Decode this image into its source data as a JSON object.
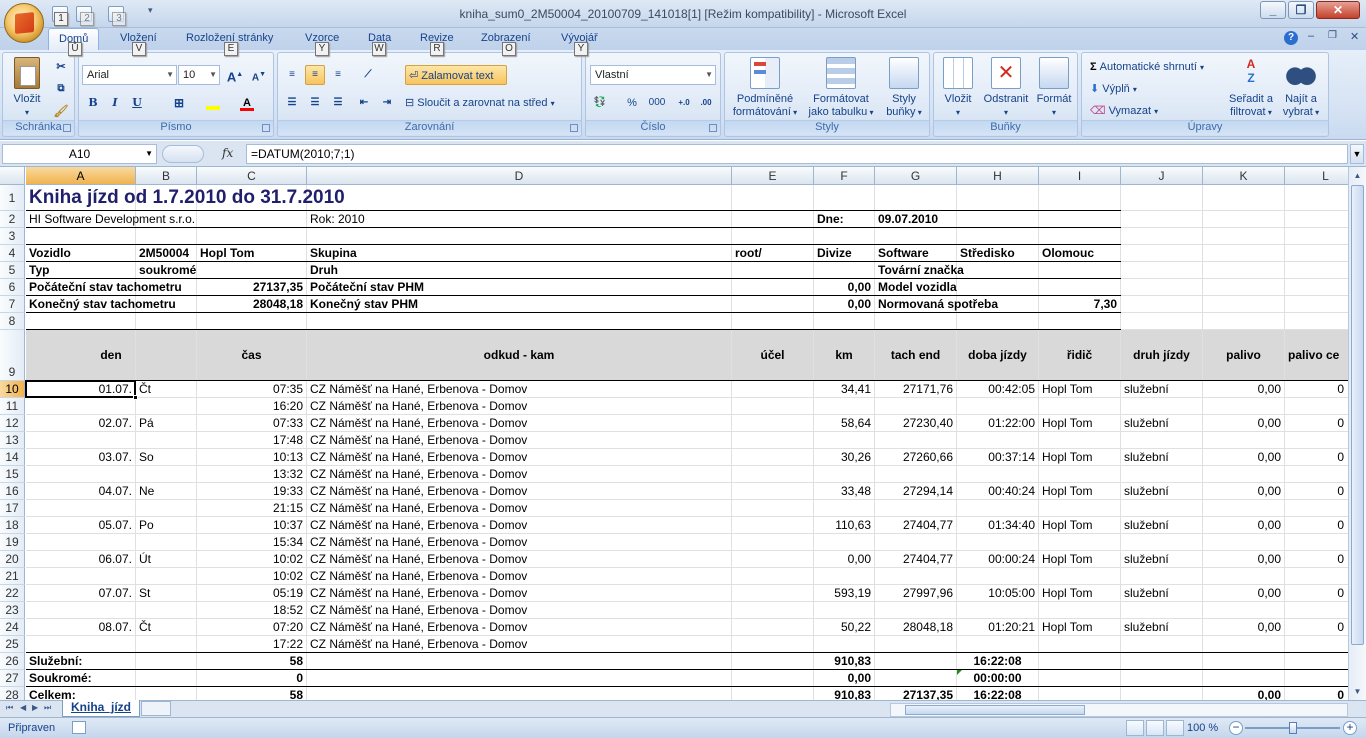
{
  "window": {
    "title": "kniha_sum0_2M50004_20100709_141018[1]  [Režim kompatibility] - Microsoft Excel",
    "qat_keytips": [
      "1",
      "2",
      "3"
    ]
  },
  "tabs": [
    {
      "label": "Domů",
      "keytip": "Ů",
      "active": true
    },
    {
      "label": "Vložení",
      "keytip": "V"
    },
    {
      "label": "Rozložení stránky",
      "keytip": "E"
    },
    {
      "label": "Vzorce",
      "keytip": "Y"
    },
    {
      "label": "Data",
      "keytip": "W"
    },
    {
      "label": "Revize",
      "keytip": "R"
    },
    {
      "label": "Zobrazení",
      "keytip": "O"
    },
    {
      "label": "Vývojář",
      "keytip": "Y"
    }
  ],
  "ribbon": {
    "schranka": {
      "label": "Schránka",
      "paste": "Vložit"
    },
    "pismo": {
      "label": "Písmo",
      "font": "Arial",
      "size": "10",
      "bold": "B",
      "italic": "I",
      "underline": "U",
      "grow": "A",
      "shrink": "A",
      "fill_color": "#ffff00",
      "font_color": "#ff0000"
    },
    "zarovnani": {
      "label": "Zarovnání",
      "wrap": "Zalamovat text",
      "merge": "Sloučit a zarovnat na střed"
    },
    "cislo": {
      "label": "Číslo",
      "format": "Vlastní",
      "percent": "%",
      "thousands": "000"
    },
    "styly": {
      "label": "Styly",
      "cond1": "Podmíněné",
      "cond2": "formátování",
      "table1": "Formátovat",
      "table2": "jako tabulku",
      "cell1": "Styly",
      "cell2": "buňky"
    },
    "bunky": {
      "label": "Buňky",
      "insert": "Vložit",
      "delete": "Odstranit",
      "format": "Formát"
    },
    "upravy": {
      "label": "Úpravy",
      "autosum": "Automatické shrnutí",
      "fill": "Výplň",
      "clear": "Vymazat",
      "sort1": "Seřadit a",
      "sort2": "filtrovat",
      "find1": "Najít a",
      "find2": "vybrat"
    }
  },
  "formula_bar": {
    "name_box": "A10",
    "fx": "fx",
    "formula": "=DATUM(2010;7;1)"
  },
  "columns": [
    "A",
    "B",
    "C",
    "D",
    "E",
    "F",
    "G",
    "H",
    "I",
    "J",
    "K",
    "L"
  ],
  "rows": [
    "1",
    "2",
    "3",
    "4",
    "5",
    "6",
    "7",
    "8",
    "9",
    "10",
    "11",
    "12",
    "13",
    "14",
    "15",
    "16",
    "17",
    "18",
    "19",
    "20",
    "21",
    "22",
    "23",
    "24",
    "25",
    "26",
    "27",
    "28"
  ],
  "sheet": {
    "title": "Kniha jízd od 1.7.2010 do 31.7.2010",
    "company": "HI Software Development s.r.o.",
    "year": "Rok: 2010",
    "date_label": "Dne:",
    "date_value": "09.07.2010",
    "r4": {
      "a": "Vozidlo",
      "b": "2M50004",
      "c": "Hopl Tom",
      "d": "Skupina",
      "e": "root/",
      "f": "Divize",
      "g": "Software",
      "h": "Středisko",
      "i": "Olomouc"
    },
    "r5": {
      "a": "Typ",
      "b": "soukromé",
      "d": "Druh",
      "g": "Tovární značka"
    },
    "r6": {
      "a": "Počáteční stav tachometru",
      "c": "27137,35",
      "d": "Počáteční stav PHM",
      "f": "0,00",
      "g": "Model vozidla"
    },
    "r7": {
      "a": "Konečný stav tachometru",
      "c": "28048,18",
      "d": "Konečný stav PHM",
      "f": "0,00",
      "g": "Normovaná spotřeba",
      "i": "7,30"
    },
    "headers": {
      "a": "den",
      "c": "čas",
      "d": "odkud - kam",
      "e": "účel",
      "f": "km",
      "g": "tach end",
      "h": "doba jízdy",
      "i": "řidič",
      "j": "druh jízdy",
      "k": "palivo",
      "l": "palivo ce"
    },
    "trips": [
      {
        "day": "01.07.",
        "dow": "Čt",
        "start": "07:35",
        "end": "16:20",
        "from": "CZ Náměšť na Hané, Erbenova - Domov",
        "to": "CZ Náměšť na Hané, Erbenova - Domov",
        "km": "34,41",
        "tach": "27171,76",
        "dur": "00:42:05",
        "driver": "Hopl Tom",
        "type": "služební",
        "fuel": "0,00",
        "fuel2": "0"
      },
      {
        "day": "02.07.",
        "dow": "Pá",
        "start": "07:33",
        "end": "17:48",
        "from": "CZ Náměšť na Hané, Erbenova - Domov",
        "to": "CZ Náměšť na Hané, Erbenova - Domov",
        "km": "58,64",
        "tach": "27230,40",
        "dur": "01:22:00",
        "driver": "Hopl Tom",
        "type": "služební",
        "fuel": "0,00",
        "fuel2": "0"
      },
      {
        "day": "03.07.",
        "dow": "So",
        "start": "10:13",
        "end": "13:32",
        "from": "CZ Náměšť na Hané, Erbenova - Domov",
        "to": "CZ Náměšť na Hané, Erbenova - Domov",
        "km": "30,26",
        "tach": "27260,66",
        "dur": "00:37:14",
        "driver": "Hopl Tom",
        "type": "služební",
        "fuel": "0,00",
        "fuel2": "0"
      },
      {
        "day": "04.07.",
        "dow": "Ne",
        "start": "19:33",
        "end": "21:15",
        "from": "CZ Náměšť na Hané, Erbenova - Domov",
        "to": "CZ Náměšť na Hané, Erbenova - Domov",
        "km": "33,48",
        "tach": "27294,14",
        "dur": "00:40:24",
        "driver": "Hopl Tom",
        "type": "služební",
        "fuel": "0,00",
        "fuel2": "0"
      },
      {
        "day": "05.07.",
        "dow": "Po",
        "start": "10:37",
        "end": "15:34",
        "from": "CZ Náměšť na Hané, Erbenova - Domov",
        "to": "CZ Náměšť na Hané, Erbenova - Domov",
        "km": "110,63",
        "tach": "27404,77",
        "dur": "01:34:40",
        "driver": "Hopl Tom",
        "type": "služební",
        "fuel": "0,00",
        "fuel2": "0"
      },
      {
        "day": "06.07.",
        "dow": "Út",
        "start": "10:02",
        "end": "10:02",
        "from": "CZ Náměšť na Hané, Erbenova - Domov",
        "to": "CZ Náměšť na Hané, Erbenova - Domov",
        "km": "0,00",
        "tach": "27404,77",
        "dur": "00:00:24",
        "driver": "Hopl Tom",
        "type": "služební",
        "fuel": "0,00",
        "fuel2": "0"
      },
      {
        "day": "07.07.",
        "dow": "St",
        "start": "05:19",
        "end": "18:52",
        "from": "CZ Náměšť na Hané, Erbenova - Domov",
        "to": "CZ Náměšť na Hané, Erbenova - Domov",
        "km": "593,19",
        "tach": "27997,96",
        "dur": "10:05:00",
        "driver": "Hopl Tom",
        "type": "služební",
        "fuel": "0,00",
        "fuel2": "0"
      },
      {
        "day": "08.07.",
        "dow": "Čt",
        "start": "07:20",
        "end": "17:22",
        "from": "CZ Náměšť na Hané, Erbenova - Domov",
        "to": "CZ Náměšť na Hané, Erbenova - Domov",
        "km": "50,22",
        "tach": "28048,18",
        "dur": "01:20:21",
        "driver": "Hopl Tom",
        "type": "služební",
        "fuel": "0,00",
        "fuel2": "0"
      }
    ],
    "totals": [
      {
        "label": "Služební:",
        "c": "58",
        "f": "910,83",
        "g": "",
        "h": "16:22:08",
        "k": "",
        "l": ""
      },
      {
        "label": "Soukromé:",
        "c": "0",
        "f": "0,00",
        "g": "",
        "h": "00:00:00",
        "k": "",
        "l": ""
      },
      {
        "label": "Celkem:",
        "c": "58",
        "f": "910,83",
        "g": "27137,35",
        "h": "16:22:08",
        "k": "0,00",
        "l": "0"
      }
    ]
  },
  "sheet_tab": "Kniha_jízd",
  "status": {
    "ready": "Připraven",
    "zoom": "100 %"
  }
}
